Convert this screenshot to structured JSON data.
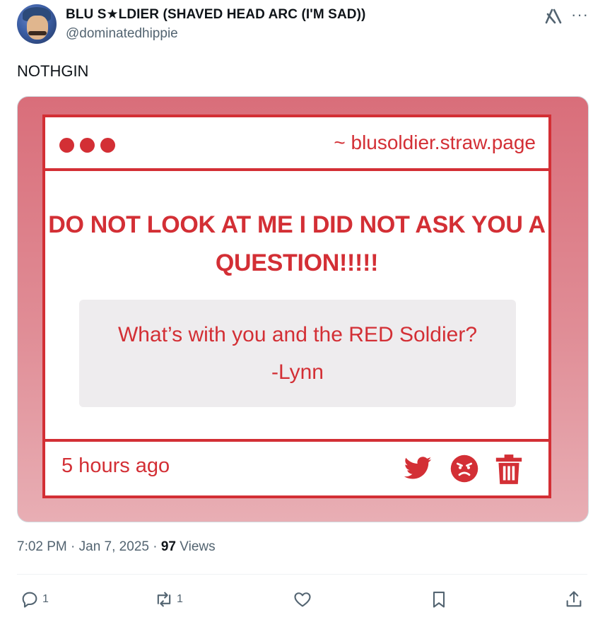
{
  "author": {
    "display_name": "BLU S★LDIER (SHAVED HEAD ARC (I'M SAD))",
    "handle": "@dominatedhippie"
  },
  "tweet": {
    "text": "NOTHGIN",
    "timestamp": "7:02 PM · Jan 7, 2025 · ",
    "views_count": "97",
    "views_label": "Views"
  },
  "media": {
    "url": "~ blusoldier.straw.page",
    "headline": "DO NOT LOOK AT ME I DID NOT ASK YOU A QUESTION!!!!!",
    "question": "What’s with you and the RED Soldier? -Lynn",
    "time_ago": "5 hours ago",
    "icons": [
      "twitter-bird-icon",
      "angry-face-icon",
      "trash-icon"
    ],
    "accent_color": "#d32f35"
  },
  "actions": {
    "replies": "1",
    "reposts": "1",
    "likes": "",
    "bookmarks": "",
    "share": ""
  },
  "header_icons": [
    "grok-icon",
    "more-icon"
  ]
}
